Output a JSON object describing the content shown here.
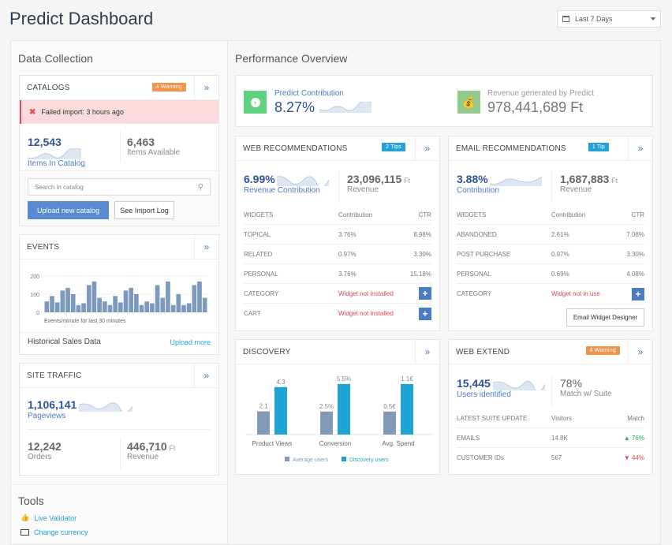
{
  "header": {
    "title": "Predict Dashboard",
    "date_range": "Last 7 Days"
  },
  "data_collection": {
    "title": "Data Collection",
    "catalogs": {
      "title": "CATALOGS",
      "badge": "4 Warning",
      "error": "Failed import: 3 hours ago",
      "items_in_catalog": "12,543",
      "items_in_catalog_label": "Items In Catalog",
      "items_available": "6,463",
      "items_available_label": "Items Available",
      "search_placeholder": "Search in catalog",
      "upload_button": "Upload new catalog",
      "import_log_button": "See Import Log"
    },
    "events": {
      "title": "EVENTS",
      "caption": "Events/minute for last 30 minutes",
      "yticks": [
        "200",
        "100",
        "0"
      ],
      "footer_label": "Historical Sales Data",
      "footer_link": "Upload more"
    },
    "site_traffic": {
      "title": "SITE TRAFFIC",
      "pageviews": "1,106,141",
      "pageviews_label": "Pageviews",
      "orders": "12,242",
      "orders_label": "Orders",
      "revenue": "446,710",
      "revenue_unit": "Ft",
      "revenue_label": "Revenue"
    },
    "tools": {
      "title": "Tools",
      "items": [
        {
          "icon": "thumbs-up-icon",
          "label": "Live Validator"
        },
        {
          "icon": "money-icon",
          "label": "Change currency"
        }
      ]
    }
  },
  "performance": {
    "title": "Performance Overview",
    "predict_contribution_label": "Predict Contribution",
    "predict_contribution": "8.27%",
    "revenue_label": "Revenue generated by Predict",
    "revenue": "978,441,689 Ft",
    "colors": {
      "contribution_icon": "#5fd17f",
      "revenue_icon": "#93c98a"
    }
  },
  "web_recommendations": {
    "title": "WEB RECOMMENDATIONS",
    "badge": "2 Tips",
    "contribution": "6.99%",
    "contribution_label": "Revenue Contribution",
    "revenue": "23,096,115",
    "revenue_unit": "Ft",
    "revenue_label": "Revenue",
    "columns": [
      "WIDGETS",
      "Contribution",
      "CTR"
    ],
    "rows": [
      {
        "name": "TOPICAL",
        "contribution": "3.76%",
        "ctr": "8.98%"
      },
      {
        "name": "RELATED",
        "contribution": "0.97%",
        "ctr": "3.30%"
      },
      {
        "name": "PERSONAL",
        "contribution": "3.76%",
        "ctr": "15.18%"
      },
      {
        "name": "CATEGORY",
        "status": "Widget not installed"
      },
      {
        "name": "CART",
        "status": "Widget not installed"
      }
    ]
  },
  "email_recommendations": {
    "title": "EMAIL RECOMMENDATIONS",
    "badge": "1 Tip",
    "contribution": "3.88%",
    "contribution_label": "Contribution",
    "revenue": "1,687,883",
    "revenue_unit": "Ft",
    "revenue_label": "Revenue",
    "columns": [
      "WIDGETS",
      "Contribution",
      "CTR"
    ],
    "rows": [
      {
        "name": "ABANDONED",
        "contribution": "2.61%",
        "ctr": "7.08%"
      },
      {
        "name": "POST PURCHASE",
        "contribution": "0.97%",
        "ctr": "3.30%"
      },
      {
        "name": "PERSONAL",
        "contribution": "0.69%",
        "ctr": "4.08%"
      },
      {
        "name": "CATEGORY",
        "status": "Widget not in use"
      }
    ],
    "designer_button": "Email Widget Designer"
  },
  "discovery": {
    "title": "DISCOVERY"
  },
  "web_extend": {
    "title": "WEB EXTEND",
    "badge": "4 Warning",
    "users": "15,445",
    "users_label": "Users identified",
    "match": "78%",
    "match_label": "Match w/ Suite",
    "columns": [
      "LATEST SUITE UPDATE",
      "Visitors",
      "Match"
    ],
    "rows": [
      {
        "name": "EMAILS",
        "visitors": "14.8K",
        "match": "76%",
        "trend": "up"
      },
      {
        "name": "CUSTOMER IDs",
        "visitors": "567",
        "match": "44%",
        "trend": "down"
      }
    ]
  },
  "chart_data": [
    {
      "type": "bar",
      "title": "Events/minute for last 30 minutes",
      "ylim": [
        0,
        200
      ],
      "yticks": [
        0,
        100,
        200
      ],
      "values": [
        60,
        90,
        55,
        120,
        135,
        100,
        40,
        50,
        150,
        170,
        80,
        60,
        40,
        90,
        55,
        120,
        135,
        100,
        40,
        60,
        50,
        150,
        80,
        170,
        40,
        100,
        40,
        50,
        150,
        170,
        80
      ],
      "color": "#7d99bd"
    },
    {
      "type": "bar",
      "title": "Discovery",
      "categories": [
        "Product Views",
        "Conversion",
        "Avg. Spend"
      ],
      "series": [
        {
          "name": "Average users",
          "values": [
            2.1,
            2.5,
            0.5
          ],
          "labels": [
            "2.1",
            "2.5%",
            "0.5€"
          ],
          "color": "#8399b8"
        },
        {
          "name": "Discovery users",
          "values": [
            4.3,
            5.5,
            1.1
          ],
          "labels": [
            "4.3",
            "5.5%",
            "1.1€"
          ],
          "color": "#1fa3d3"
        }
      ],
      "legend": "bottom"
    }
  ]
}
